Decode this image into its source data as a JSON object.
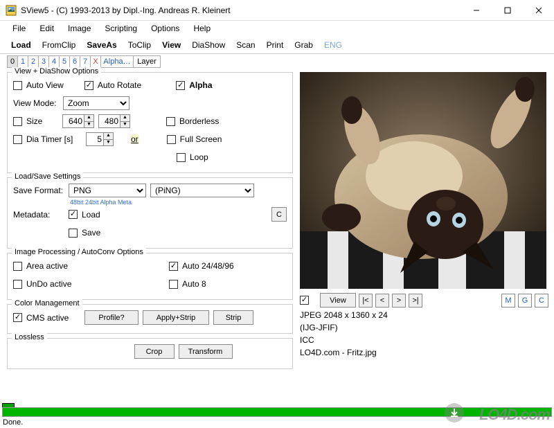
{
  "window": {
    "title": "SView5 - (C) 1993-2013 by Dipl.-Ing. Andreas R. Kleinert"
  },
  "menu": {
    "file": "File",
    "edit": "Edit",
    "image": "Image",
    "scripting": "Scripting",
    "options": "Options",
    "help": "Help"
  },
  "toolbar": {
    "load": "Load",
    "fromclip": "FromClip",
    "saveas": "SaveAs",
    "toclip": "ToClip",
    "view": "View",
    "diashow": "DiaShow",
    "scan": "Scan",
    "print": "Print",
    "grab": "Grab",
    "eng": "ENG"
  },
  "tabs": {
    "t0": "0",
    "t1": "1",
    "t2": "2",
    "t3": "3",
    "t4": "4",
    "t5": "5",
    "t6": "6",
    "t7": "7",
    "x": "X",
    "alpha": "Alpha…",
    "layer": "Layer"
  },
  "view_dia": {
    "title": "View + DiaShow Options",
    "auto_view": "Auto View",
    "auto_rotate": "Auto Rotate",
    "alpha": "Alpha",
    "view_mode_label": "View Mode:",
    "view_mode_value": "Zoom",
    "size": "Size",
    "width": "640",
    "height": "480",
    "dia_timer": "Dia Timer [s]",
    "dia_timer_value": "5",
    "or": "or",
    "borderless": "Borderless",
    "fullscreen": "Full Screen",
    "loop": "Loop"
  },
  "loadsave": {
    "title": "Load/Save Settings",
    "save_format_label": "Save Format:",
    "fmt1": "PNG",
    "fmt2": "(PiNG)",
    "note": "48bit 24bit Alpha Meta",
    "c": "C",
    "metadata": "Metadata:",
    "load": "Load",
    "save": "Save"
  },
  "improc": {
    "title": "Image Processing / AutoConv Options",
    "area": "Area active",
    "auto24": "Auto 24/48/96",
    "undo": "UnDo active",
    "auto8": "Auto 8"
  },
  "cms": {
    "title": "Color Management",
    "active": "CMS active",
    "profile": "Profile?",
    "apply": "Apply+Strip",
    "strip": "Strip"
  },
  "lossless": {
    "title": "Lossless",
    "crop": "Crop",
    "transform": "Transform"
  },
  "preview_controls": {
    "view": "View",
    "m": "M",
    "g": "G",
    "c": "C"
  },
  "image_info": {
    "line1": "JPEG 2048 x 1360 x 24",
    "line2": "(IJG-JFIF)",
    "line3": "ICC",
    "line4": "LO4D.com - Fritz.jpg"
  },
  "status": {
    "done": "Done."
  },
  "watermark": "LO4D.com"
}
